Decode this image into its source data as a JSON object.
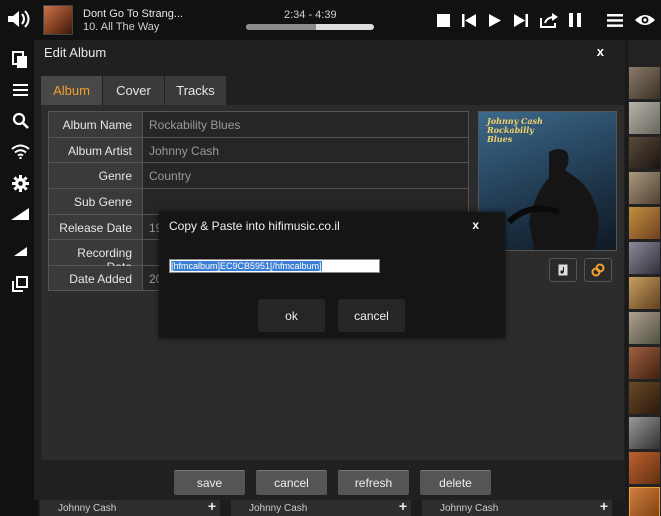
{
  "now_playing": {
    "title": "Dont Go To Strang...",
    "track": "10. All The Way",
    "time": "2:34 - 4:39",
    "progress": 0.55
  },
  "dialog": {
    "title": "Edit Album",
    "close": "x",
    "tabs": [
      {
        "label": "Album"
      },
      {
        "label": "Cover"
      },
      {
        "label": "Tracks"
      }
    ],
    "fields": [
      {
        "label": "Album Name",
        "value": "Rockability Blues"
      },
      {
        "label": "Album Artist",
        "value": "Johnny Cash"
      },
      {
        "label": "Genre",
        "value": "Country"
      },
      {
        "label": "Sub Genre",
        "value": ""
      },
      {
        "label": "Release Date",
        "value": "19"
      },
      {
        "label": "Recording Date",
        "value": ""
      },
      {
        "label": "Date Added",
        "value": "20"
      }
    ],
    "cover": {
      "line1": "Johnny Cash",
      "line2": "Rockabilly",
      "line3": "Blues"
    },
    "buttons": {
      "save": "save",
      "cancel": "cancel",
      "refresh": "refresh",
      "delete": "delete"
    }
  },
  "copy_dialog": {
    "title": "Copy & Paste into hifimusic.co.il",
    "close": "x",
    "value": "[hfmcalbum]EC9CB5951[/hfmcalbum]",
    "ok": "ok",
    "cancel": "cancel"
  },
  "bottom_strip": [
    {
      "label": "Johnny Cash"
    },
    {
      "label": "Johnny Cash"
    },
    {
      "label": "Johnny Cash"
    }
  ],
  "colors": {
    "accent": "#f0a030",
    "selection": "#3b7fd4"
  },
  "icons": [
    "volume-icon",
    "stop-icon",
    "previous-icon",
    "play-icon",
    "next-icon",
    "share-icon",
    "pause-icon",
    "menu-icon",
    "eye-icon",
    "copy-icon",
    "list-icon",
    "search-icon",
    "wifi-icon",
    "gear-icon",
    "signal-icon",
    "signal-small-icon",
    "windows-icon",
    "music-file-icon",
    "link-icon"
  ]
}
